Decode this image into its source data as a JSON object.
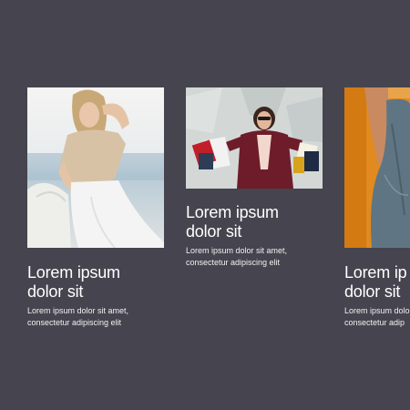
{
  "cards": [
    {
      "image": "woman-white-outfit-beach-photo",
      "title_line1": "Lorem ipsum",
      "title_line2": "dolor sit",
      "body_line1": "Lorem ipsum dolor sit amet,",
      "body_line2": "consectetur adipiscing elit"
    },
    {
      "image": "woman-shopping-bags-photo",
      "title_line1": "Lorem ipsum",
      "title_line2": "dolor sit",
      "body_line1": "Lorem ipsum dolor sit amet,",
      "body_line2": "consectetur adipiscing elit"
    },
    {
      "image": "hand-in-denim-pocket-photo",
      "title_line1": "Lorem ip",
      "title_line2": "dolor sit",
      "body_line1": "Lorem ipsum dolo",
      "body_line2": "consectetur adip"
    }
  ],
  "colors": {
    "background": "#46444e",
    "text": "#ffffff"
  }
}
